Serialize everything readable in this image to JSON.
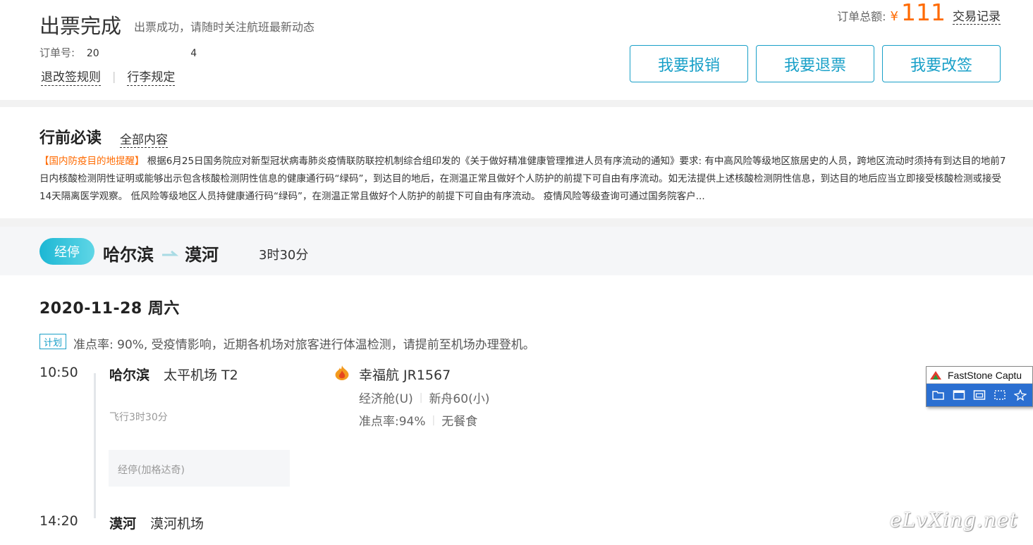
{
  "header": {
    "title": "出票完成",
    "subtitle": "出票成功，请随时关注航班最新动态",
    "order_label": "订单号:",
    "order_fragment_1": "20",
    "order_fragment_2": "4",
    "link_rules": "退改签规则",
    "link_separator": "|",
    "link_baggage": "行李规定",
    "total_label": "订单总额:",
    "currency": "¥",
    "total_amount": "111",
    "transactions_link": "交易记录",
    "btn_reimburse": "我要报销",
    "btn_refund": "我要退票",
    "btn_change": "我要改签"
  },
  "notice": {
    "title": "行前必读",
    "all_link": "全部内容",
    "highlight": "【国内防疫目的地提醒】",
    "body": " 根据6月25日国务院应对新型冠状病毒肺炎疫情联防联控机制综合组印发的《关于做好精准健康管理推进人员有序流动的通知》要求: 有中高风险等级地区旅居史的人员，跨地区流动时须持有到达目的地前7日内核酸检测阴性证明或能够出示包含核酸检测阴性信息的健康通行码“绿码”，到达目的地后，在测温正常且做好个人防护的前提下可自由有序流动。如无法提供上述核酸检测阴性信息，到达目的地后应当立即接受核酸检测或接受14天隔离医学观察。 低风险等级地区人员持健康通行码“绿码”，在测温正常且做好个人防护的前提下可自由有序流动。 疫情风险等级查询可通过国务院客户..."
  },
  "route": {
    "badge": "经停",
    "from": "哈尔滨",
    "arrow": "⟶",
    "to": "漠河",
    "duration": "3时30分"
  },
  "flight": {
    "date": "2020-11-28   周六",
    "plan_tag": "计划",
    "plan_text": "准点率: 90%, 受疫情影响，近期各机场对旅客进行体温检测，请提前至机场办理登机。",
    "dep_time": "10:50",
    "dep_city": "哈尔滨",
    "dep_airport": "太平机场 T2",
    "fly_duration": "飞行3时30分",
    "via": "经停(加格达奇)",
    "arr_time": "14:20",
    "arr_city": "漠河",
    "arr_airport": "漠河机场",
    "airline": "幸福航 JR1567",
    "cabin": "经济舱(U)",
    "aircraft": "新舟60(小)",
    "ontime": "准点率:94%",
    "meal": "无餐食",
    "sep": "|",
    "airline_logo_icon": "flame-logo-icon"
  },
  "faststone": {
    "title": "FastStone Captu"
  },
  "watermark": "eLvXing.net",
  "colors": {
    "accent": "#19a0c8",
    "price": "#ff6a00",
    "badge_start": "#1cb7d4",
    "badge_end": "#5fd6e6"
  }
}
